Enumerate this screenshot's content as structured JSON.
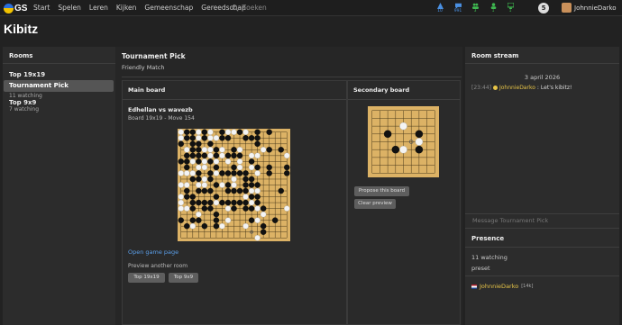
{
  "nav": {
    "logo_text": "GS",
    "items": [
      "Start",
      "Spelen",
      "Leren",
      "Kijken",
      "Gemeenschap",
      "Gereedschap"
    ],
    "search_placeholder": "Zoeken",
    "stats": [
      {
        "icon": "triangle-icon",
        "count": "10",
        "color": "#4a90e2"
      },
      {
        "icon": "chat-icon",
        "count": "991",
        "color": "#4a90e2"
      },
      {
        "icon": "users-icon",
        "count": "3",
        "color": "#3fb950"
      },
      {
        "icon": "person-icon",
        "count": "1",
        "color": "#3fb950"
      },
      {
        "icon": "monitor-icon",
        "count": "1",
        "color": "#3fb950"
      }
    ],
    "notification_count": "5",
    "username": "JohnnieDarko"
  },
  "page_title": "Kibitz",
  "rooms": {
    "heading": "Rooms",
    "items": [
      {
        "name": "Top 19x19",
        "watching": "",
        "selected": false
      },
      {
        "name": "Tournament Pick",
        "watching": "11 watching",
        "selected": true
      },
      {
        "name": "Top 9x9",
        "watching": "7 watching",
        "selected": false
      }
    ]
  },
  "main": {
    "title": "Tournament Pick",
    "subtitle": "Friendly Match",
    "main_board": {
      "heading": "Main board",
      "players": "Edhellan vs wavezb",
      "info": "Board 19x19 - Move 154",
      "open_link": "Open game page",
      "preview_label": "Preview another room",
      "preview_buttons": [
        "Top 19x19",
        "Top 9x9"
      ]
    },
    "secondary_board": {
      "heading": "Secondary board",
      "propose_button": "Propose this board",
      "clear_button": "Clear preview"
    }
  },
  "stream": {
    "heading": "Room stream",
    "date": "3 april 2026",
    "messages": [
      {
        "time": "[23:44]",
        "user": "JohnnieDarko",
        "text": "Let's kibitz!"
      }
    ],
    "input_placeholder": "Message Tournament Pick",
    "presence_heading": "Presence",
    "presence_count": "11 watching",
    "presence_preset": "preset",
    "presence_user": "JohnnieDarko",
    "presence_rank": "[14k]"
  },
  "colors": {
    "board": "#dcb265",
    "link": "#5a9ee8",
    "username": "#e8c547",
    "selected_room": "#555555"
  }
}
